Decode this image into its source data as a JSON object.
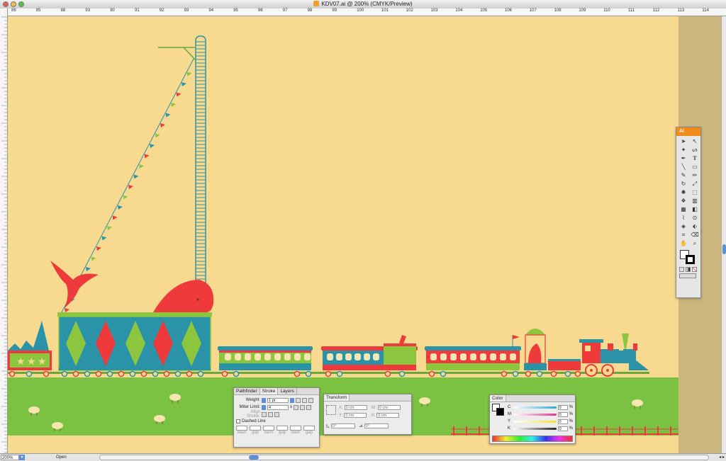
{
  "window": {
    "title": "KDV07.ai @ 200% (CMYK/Preview)",
    "lights": [
      "#ee5b50",
      "#f4bf3a",
      "#58c24a"
    ]
  },
  "ruler": {
    "ticks": [
      "86",
      "85",
      "88",
      "93",
      "90",
      "91",
      "92",
      "93",
      "94",
      "95",
      "96",
      "97",
      "98",
      "99",
      "100",
      "101",
      "102",
      "103",
      "104",
      "105",
      "106",
      "107",
      "108",
      "109",
      "110",
      "111",
      "112",
      "113",
      "114"
    ]
  },
  "colors": {
    "canvas": "#f7d98f",
    "grass": "#7cc242",
    "red": "#ee3a3a",
    "teal": "#2a93a8",
    "green": "#8cc63f"
  },
  "stroke_panel": {
    "tabs": [
      "Pathfinder",
      "Stroke",
      "Layers"
    ],
    "weight_label": "Weight:",
    "weight_value": "1 pt",
    "miter_label": "Miter Limit:",
    "miter_value": "4",
    "miter_unit": "x",
    "align_label": "Align Stroke:",
    "dashed_label": "Dashed Line",
    "dash_labels": [
      "dash",
      "gap",
      "dash",
      "gap",
      "dash",
      "gap"
    ]
  },
  "transform_panel": {
    "tab": "Transform",
    "x_label": "X:",
    "x_value": "0 cm",
    "y_label": "Y:",
    "y_value": "0 cm",
    "w_label": "W:",
    "w_value": "0 cm",
    "h_label": "H:",
    "h_value": "0 cm",
    "rotate_value": "0°",
    "shear_value": "0°"
  },
  "color_panel": {
    "tab": "Color",
    "channels": [
      {
        "label": "C",
        "value": "0",
        "unit": "%",
        "color": "#2aa8d8"
      },
      {
        "label": "M",
        "value": "0",
        "unit": "%",
        "color": "#e0338c"
      },
      {
        "label": "Y",
        "value": "0",
        "unit": "%",
        "color": "#f2e230"
      },
      {
        "label": "K",
        "value": "0",
        "unit": "%",
        "color": "#222222"
      }
    ]
  },
  "toolbox": {
    "header": "Ai"
  },
  "status": {
    "zoom": "200%",
    "mode": "Open"
  }
}
